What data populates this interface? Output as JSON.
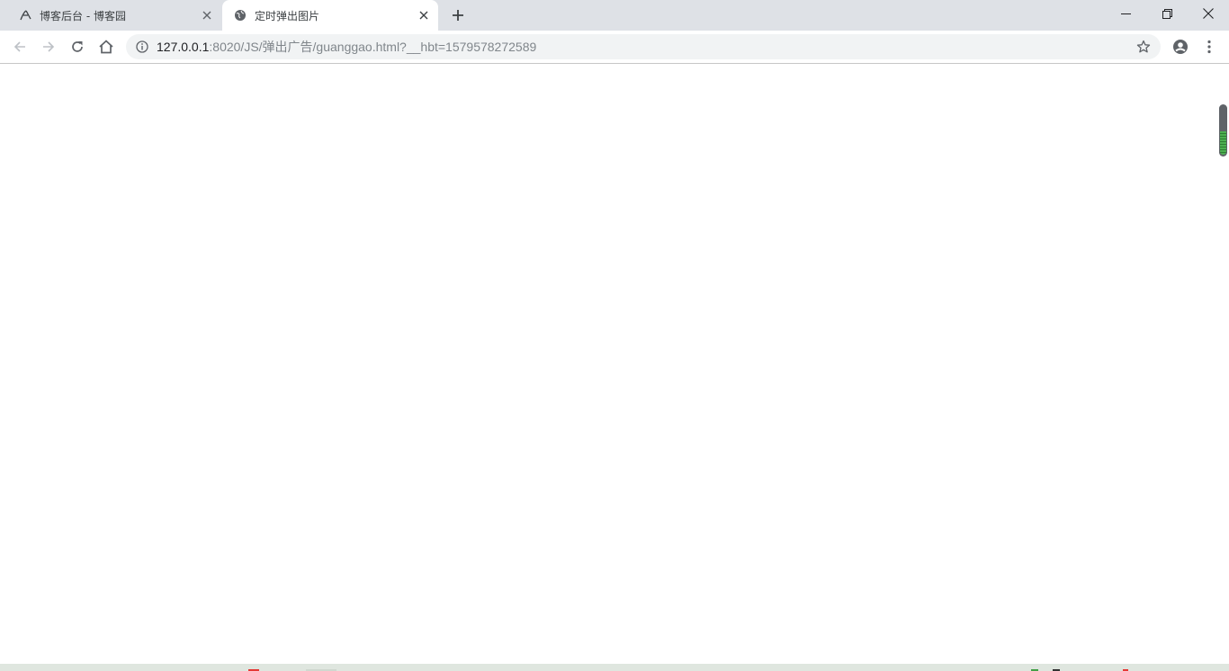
{
  "tabs": [
    {
      "title": "博客后台 - 博客园",
      "icon": "cnblogs-icon",
      "active": false
    },
    {
      "title": "定时弹出图片",
      "icon": "globe-icon",
      "active": true
    }
  ],
  "address": {
    "host": "127.0.0.1",
    "path": ":8020/JS/弹出广告/guanggao.html?__hbt=1579578272589"
  },
  "icons": {
    "back": "back-arrow-icon",
    "forward": "forward-arrow-icon",
    "reload": "reload-icon",
    "home": "home-icon",
    "info": "info-icon",
    "bookmark": "star-icon",
    "profile": "account-icon",
    "menu": "kebab-menu-icon"
  },
  "colors": {
    "tabstrip": "#dee1e6",
    "omnibox": "#f1f3f4",
    "scrollbar_accent": "#4caf50"
  }
}
